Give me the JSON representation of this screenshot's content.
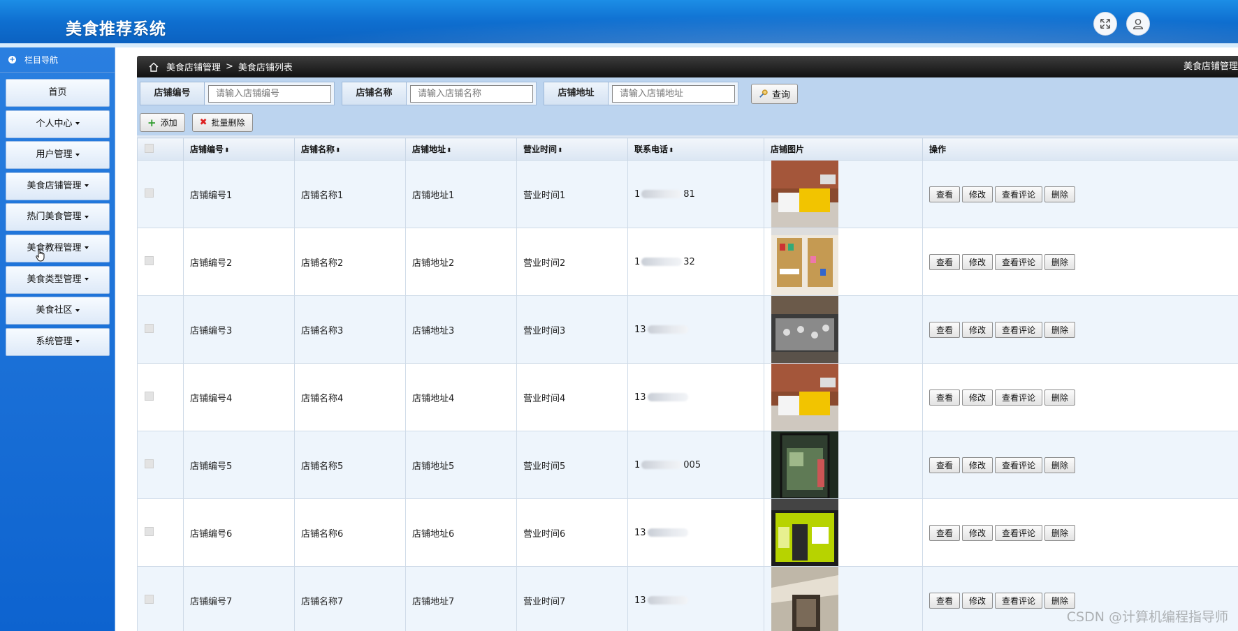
{
  "app": {
    "title": "美食推荐系统"
  },
  "header": {
    "fullscreen_icon": "expand-icon",
    "user_icon": "user-icon"
  },
  "sidebar": {
    "heading": "栏目导航",
    "items": [
      {
        "label": "首页",
        "dropdown": false
      },
      {
        "label": "个人中心",
        "dropdown": true
      },
      {
        "label": "用户管理",
        "dropdown": true
      },
      {
        "label": "美食店铺管理",
        "dropdown": true
      },
      {
        "label": "热门美食管理",
        "dropdown": true
      },
      {
        "label": "美食教程管理",
        "dropdown": true
      },
      {
        "label": "美食类型管理",
        "dropdown": true
      },
      {
        "label": "美食社区",
        "dropdown": true
      },
      {
        "label": "系统管理",
        "dropdown": true
      }
    ]
  },
  "breadcrumb": {
    "parent": "美食店铺管理",
    "separator": ">",
    "current": "美食店铺列表",
    "right": "美食店铺管理"
  },
  "search": {
    "fields": [
      {
        "label": "店铺编号",
        "placeholder": "请输入店铺编号"
      },
      {
        "label": "店铺名称",
        "placeholder": "请输入店铺名称"
      },
      {
        "label": "店铺地址",
        "placeholder": "请输入店铺地址"
      }
    ],
    "query_label": "查询"
  },
  "toolbar": {
    "add_label": "添加",
    "batch_delete_label": "批量删除"
  },
  "table": {
    "columns": [
      "店铺编号",
      "店铺名称",
      "店铺地址",
      "营业时间",
      "联系电话",
      "店铺图片",
      "操作"
    ],
    "sortable_marker": "⬍",
    "row_actions": [
      "查看",
      "修改",
      "查看评论",
      "删除"
    ],
    "rows": [
      {
        "id": "店铺编号1",
        "name": "店铺名称1",
        "address": "店铺地址1",
        "hours": "营业时间1",
        "phone_start": "1",
        "phone_end": "81",
        "image": "counter-yellow"
      },
      {
        "id": "店铺编号2",
        "name": "店铺名称2",
        "address": "店铺地址2",
        "hours": "营业时间2",
        "phone_start": "1",
        "phone_end": "32",
        "image": "shelf-display"
      },
      {
        "id": "店铺编号3",
        "name": "店铺名称3",
        "address": "店铺地址3",
        "hours": "营业时间3",
        "phone_start": "13",
        "phone_end": "",
        "image": "wall-display"
      },
      {
        "id": "店铺编号4",
        "name": "店铺名称4",
        "address": "店铺地址4",
        "hours": "营业时间4",
        "phone_start": "13",
        "phone_end": "",
        "image": "counter-yellow"
      },
      {
        "id": "店铺编号5",
        "name": "店铺名称5",
        "address": "店铺地址5",
        "hours": "营业时间5",
        "phone_start": "1",
        "phone_end": "005",
        "image": "glass-door"
      },
      {
        "id": "店铺编号6",
        "name": "店铺名称6",
        "address": "店铺地址6",
        "hours": "营业时间6",
        "phone_start": "13",
        "phone_end": "",
        "image": "lime-storefront"
      },
      {
        "id": "店铺编号7",
        "name": "店铺名称7",
        "address": "店铺地址7",
        "hours": "营业时间7",
        "phone_start": "13",
        "phone_end": "",
        "image": "shop-entrance"
      }
    ]
  },
  "watermark": "CSDN @计算机编程指导师"
}
